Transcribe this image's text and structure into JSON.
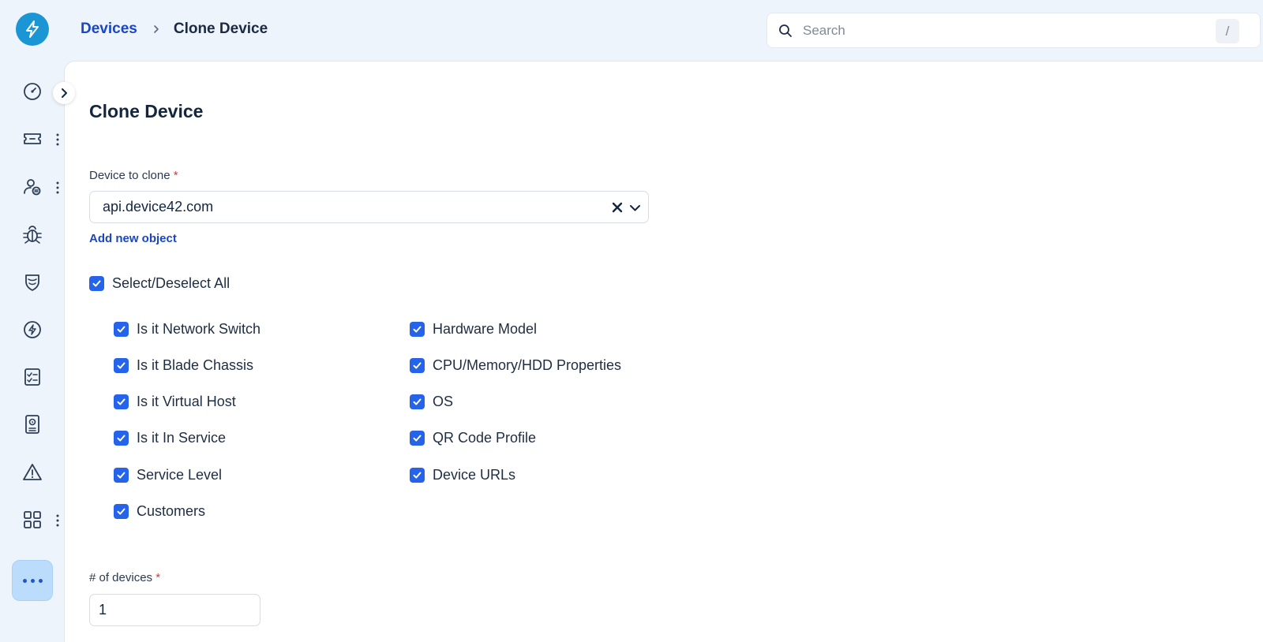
{
  "colors": {
    "brand": "#1a96d4",
    "accent": "#2563eb",
    "link": "#1a46c4",
    "required": "#d43a3a"
  },
  "breadcrumb": {
    "parent": "Devices",
    "current": "Clone Device"
  },
  "search": {
    "placeholder": "Search",
    "shortcut": "/"
  },
  "sidebar": {
    "icons": [
      "dashboard-icon",
      "ticket-icon",
      "users-icon",
      "bug-icon",
      "shield-icon",
      "lightning-icon",
      "checklist-icon",
      "badge-icon",
      "warning-icon",
      "apps-grid-icon",
      "more-icon"
    ]
  },
  "form": {
    "title": "Clone Device",
    "device_label": "Device to clone",
    "required_mark": "*",
    "device_value": "api.device42.com",
    "add_link": "Add new object",
    "select_all_label": "Select/Deselect All",
    "options_left": [
      {
        "label": "Is it Network Switch",
        "checked": true
      },
      {
        "label": "Is it Blade Chassis",
        "checked": true
      },
      {
        "label": "Is it Virtual Host",
        "checked": true
      },
      {
        "label": "Is it In Service",
        "checked": true
      },
      {
        "label": "Service Level",
        "checked": true
      },
      {
        "label": "Customers",
        "checked": true
      }
    ],
    "options_right": [
      {
        "label": "Hardware Model",
        "checked": true
      },
      {
        "label": "CPU/Memory/HDD Properties",
        "checked": true
      },
      {
        "label": "OS",
        "checked": true
      },
      {
        "label": "QR Code Profile",
        "checked": true
      },
      {
        "label": "Device URLs",
        "checked": true
      }
    ],
    "count_label": "# of devices",
    "count_value": "1"
  }
}
